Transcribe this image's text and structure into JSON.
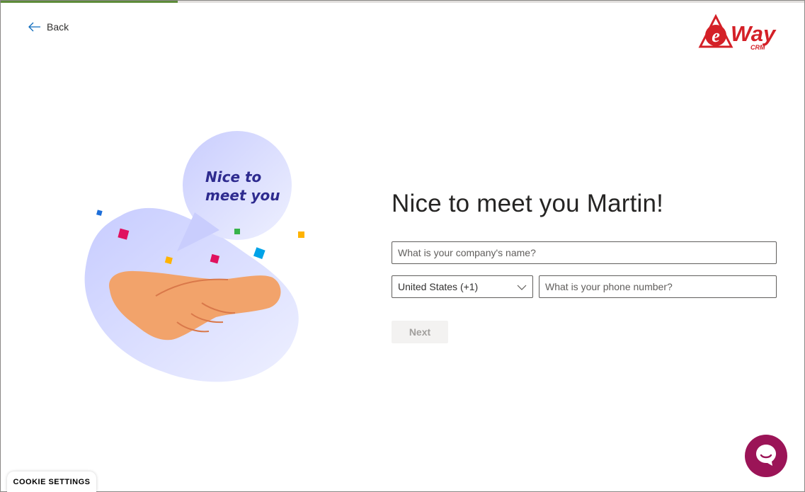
{
  "progress": {
    "fraction": 0.22
  },
  "nav": {
    "back_label": "Back"
  },
  "brand": {
    "logo_text": "Way",
    "logo_letter": "e",
    "logo_sub": "CRM",
    "color": "#d42027"
  },
  "illustration": {
    "bubble_line1": "Nice to",
    "bubble_line2": "meet you"
  },
  "form": {
    "heading": "Nice to meet you Martin!",
    "company_placeholder": "What is your company's name?",
    "country_value": "United States (+1)",
    "phone_placeholder": "What is your phone number?",
    "next_label": "Next"
  },
  "footer": {
    "cookie_label": "COOKIE SETTINGS"
  },
  "colors": {
    "accent": "#5e8c3a",
    "chat": "#9b1457"
  }
}
